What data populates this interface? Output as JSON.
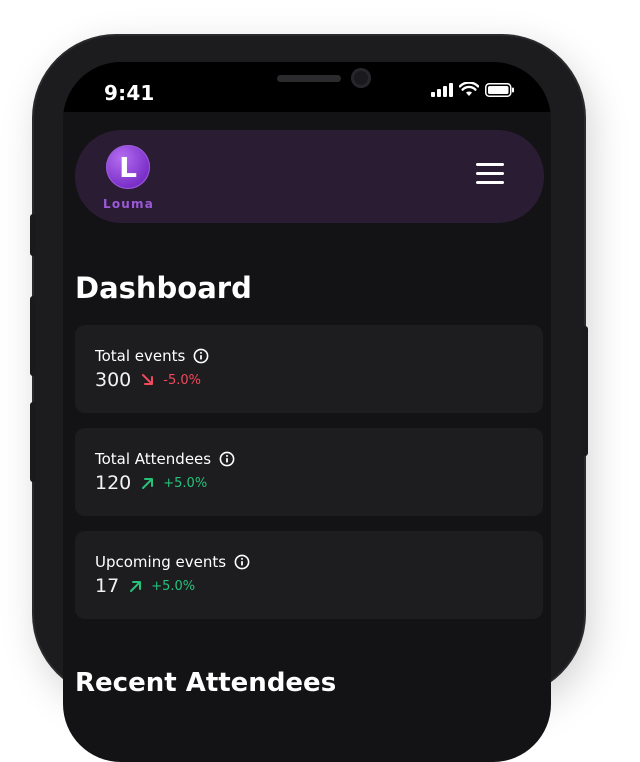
{
  "status_bar": {
    "time": "9:41"
  },
  "header": {
    "logo_letter": "L",
    "logo_text": "Louma"
  },
  "page": {
    "title": "Dashboard",
    "next_section_partial": "Recent Attendees"
  },
  "cards": [
    {
      "label": "Total events",
      "value": "300",
      "trend": "down",
      "change": "-5.0%"
    },
    {
      "label": "Total Attendees",
      "value": "120",
      "trend": "up",
      "change": "+5.0%"
    },
    {
      "label": "Upcoming events",
      "value": "17",
      "trend": "up",
      "change": "+5.0%"
    }
  ],
  "colors": {
    "accent": "#7a2fc8",
    "nav_background": "#2a1c33",
    "card_background": "#1d1c1f",
    "negative": "#f04a5c",
    "positive": "#26c27a"
  },
  "icons": {
    "info": "info-icon",
    "trend_down": "arrow-down-right-icon",
    "trend_up": "arrow-up-right-icon",
    "menu": "hamburger-menu-icon"
  }
}
